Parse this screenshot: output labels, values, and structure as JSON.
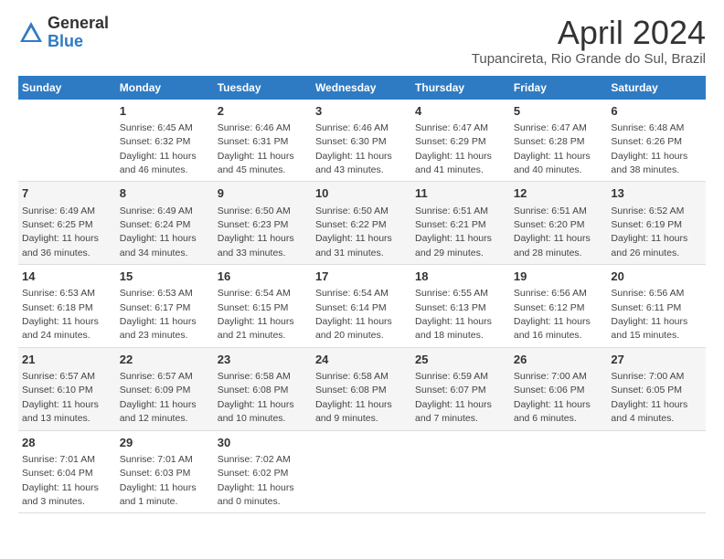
{
  "header": {
    "logo_general": "General",
    "logo_blue": "Blue",
    "month_title": "April 2024",
    "location": "Tupancireta, Rio Grande do Sul, Brazil"
  },
  "days_of_week": [
    "Sunday",
    "Monday",
    "Tuesday",
    "Wednesday",
    "Thursday",
    "Friday",
    "Saturday"
  ],
  "weeks": [
    [
      {
        "day": "",
        "sunrise": "",
        "sunset": "",
        "daylight": ""
      },
      {
        "day": "1",
        "sunrise": "Sunrise: 6:45 AM",
        "sunset": "Sunset: 6:32 PM",
        "daylight": "Daylight: 11 hours and 46 minutes."
      },
      {
        "day": "2",
        "sunrise": "Sunrise: 6:46 AM",
        "sunset": "Sunset: 6:31 PM",
        "daylight": "Daylight: 11 hours and 45 minutes."
      },
      {
        "day": "3",
        "sunrise": "Sunrise: 6:46 AM",
        "sunset": "Sunset: 6:30 PM",
        "daylight": "Daylight: 11 hours and 43 minutes."
      },
      {
        "day": "4",
        "sunrise": "Sunrise: 6:47 AM",
        "sunset": "Sunset: 6:29 PM",
        "daylight": "Daylight: 11 hours and 41 minutes."
      },
      {
        "day": "5",
        "sunrise": "Sunrise: 6:47 AM",
        "sunset": "Sunset: 6:28 PM",
        "daylight": "Daylight: 11 hours and 40 minutes."
      },
      {
        "day": "6",
        "sunrise": "Sunrise: 6:48 AM",
        "sunset": "Sunset: 6:26 PM",
        "daylight": "Daylight: 11 hours and 38 minutes."
      }
    ],
    [
      {
        "day": "7",
        "sunrise": "Sunrise: 6:49 AM",
        "sunset": "Sunset: 6:25 PM",
        "daylight": "Daylight: 11 hours and 36 minutes."
      },
      {
        "day": "8",
        "sunrise": "Sunrise: 6:49 AM",
        "sunset": "Sunset: 6:24 PM",
        "daylight": "Daylight: 11 hours and 34 minutes."
      },
      {
        "day": "9",
        "sunrise": "Sunrise: 6:50 AM",
        "sunset": "Sunset: 6:23 PM",
        "daylight": "Daylight: 11 hours and 33 minutes."
      },
      {
        "day": "10",
        "sunrise": "Sunrise: 6:50 AM",
        "sunset": "Sunset: 6:22 PM",
        "daylight": "Daylight: 11 hours and 31 minutes."
      },
      {
        "day": "11",
        "sunrise": "Sunrise: 6:51 AM",
        "sunset": "Sunset: 6:21 PM",
        "daylight": "Daylight: 11 hours and 29 minutes."
      },
      {
        "day": "12",
        "sunrise": "Sunrise: 6:51 AM",
        "sunset": "Sunset: 6:20 PM",
        "daylight": "Daylight: 11 hours and 28 minutes."
      },
      {
        "day": "13",
        "sunrise": "Sunrise: 6:52 AM",
        "sunset": "Sunset: 6:19 PM",
        "daylight": "Daylight: 11 hours and 26 minutes."
      }
    ],
    [
      {
        "day": "14",
        "sunrise": "Sunrise: 6:53 AM",
        "sunset": "Sunset: 6:18 PM",
        "daylight": "Daylight: 11 hours and 24 minutes."
      },
      {
        "day": "15",
        "sunrise": "Sunrise: 6:53 AM",
        "sunset": "Sunset: 6:17 PM",
        "daylight": "Daylight: 11 hours and 23 minutes."
      },
      {
        "day": "16",
        "sunrise": "Sunrise: 6:54 AM",
        "sunset": "Sunset: 6:15 PM",
        "daylight": "Daylight: 11 hours and 21 minutes."
      },
      {
        "day": "17",
        "sunrise": "Sunrise: 6:54 AM",
        "sunset": "Sunset: 6:14 PM",
        "daylight": "Daylight: 11 hours and 20 minutes."
      },
      {
        "day": "18",
        "sunrise": "Sunrise: 6:55 AM",
        "sunset": "Sunset: 6:13 PM",
        "daylight": "Daylight: 11 hours and 18 minutes."
      },
      {
        "day": "19",
        "sunrise": "Sunrise: 6:56 AM",
        "sunset": "Sunset: 6:12 PM",
        "daylight": "Daylight: 11 hours and 16 minutes."
      },
      {
        "day": "20",
        "sunrise": "Sunrise: 6:56 AM",
        "sunset": "Sunset: 6:11 PM",
        "daylight": "Daylight: 11 hours and 15 minutes."
      }
    ],
    [
      {
        "day": "21",
        "sunrise": "Sunrise: 6:57 AM",
        "sunset": "Sunset: 6:10 PM",
        "daylight": "Daylight: 11 hours and 13 minutes."
      },
      {
        "day": "22",
        "sunrise": "Sunrise: 6:57 AM",
        "sunset": "Sunset: 6:09 PM",
        "daylight": "Daylight: 11 hours and 12 minutes."
      },
      {
        "day": "23",
        "sunrise": "Sunrise: 6:58 AM",
        "sunset": "Sunset: 6:08 PM",
        "daylight": "Daylight: 11 hours and 10 minutes."
      },
      {
        "day": "24",
        "sunrise": "Sunrise: 6:58 AM",
        "sunset": "Sunset: 6:08 PM",
        "daylight": "Daylight: 11 hours and 9 minutes."
      },
      {
        "day": "25",
        "sunrise": "Sunrise: 6:59 AM",
        "sunset": "Sunset: 6:07 PM",
        "daylight": "Daylight: 11 hours and 7 minutes."
      },
      {
        "day": "26",
        "sunrise": "Sunrise: 7:00 AM",
        "sunset": "Sunset: 6:06 PM",
        "daylight": "Daylight: 11 hours and 6 minutes."
      },
      {
        "day": "27",
        "sunrise": "Sunrise: 7:00 AM",
        "sunset": "Sunset: 6:05 PM",
        "daylight": "Daylight: 11 hours and 4 minutes."
      }
    ],
    [
      {
        "day": "28",
        "sunrise": "Sunrise: 7:01 AM",
        "sunset": "Sunset: 6:04 PM",
        "daylight": "Daylight: 11 hours and 3 minutes."
      },
      {
        "day": "29",
        "sunrise": "Sunrise: 7:01 AM",
        "sunset": "Sunset: 6:03 PM",
        "daylight": "Daylight: 11 hours and 1 minute."
      },
      {
        "day": "30",
        "sunrise": "Sunrise: 7:02 AM",
        "sunset": "Sunset: 6:02 PM",
        "daylight": "Daylight: 11 hours and 0 minutes."
      },
      {
        "day": "",
        "sunrise": "",
        "sunset": "",
        "daylight": ""
      },
      {
        "day": "",
        "sunrise": "",
        "sunset": "",
        "daylight": ""
      },
      {
        "day": "",
        "sunrise": "",
        "sunset": "",
        "daylight": ""
      },
      {
        "day": "",
        "sunrise": "",
        "sunset": "",
        "daylight": ""
      }
    ]
  ]
}
